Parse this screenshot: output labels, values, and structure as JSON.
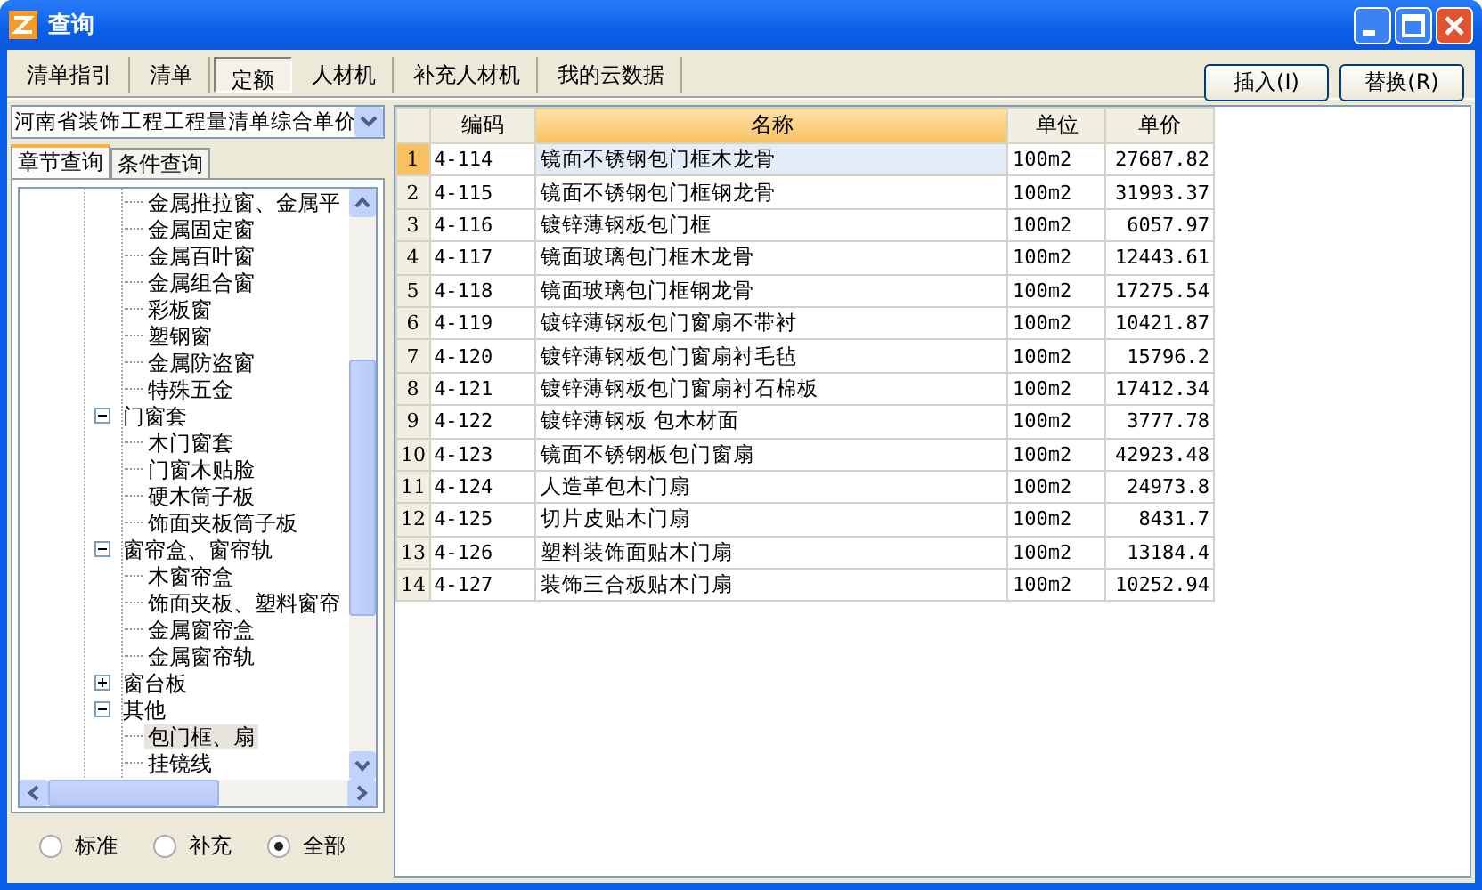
{
  "window": {
    "title": "查询"
  },
  "tabs": [
    {
      "label": "清单指引",
      "selected": false
    },
    {
      "label": "清单",
      "selected": false
    },
    {
      "label": "定额",
      "selected": true
    },
    {
      "label": "人材机",
      "selected": false
    },
    {
      "label": "补充人材机",
      "selected": false
    },
    {
      "label": "我的云数据",
      "selected": false
    }
  ],
  "buttons": [
    "插入(I)",
    "替换(R)"
  ],
  "library": {
    "value": "河南省装饰工程工程量清单综合单价"
  },
  "search_tabs": [
    {
      "label": "章节查询",
      "selected": true
    },
    {
      "label": "条件查询",
      "selected": false
    }
  ],
  "tree": [
    {
      "children": [
        {
          "label": "金属推拉窗、金属平",
          "selected": false
        },
        {
          "label": "金属固定窗",
          "selected": false
        },
        {
          "label": "金属百叶窗",
          "selected": false
        },
        {
          "label": "金属组合窗",
          "selected": false
        },
        {
          "label": "彩板窗",
          "selected": false
        },
        {
          "label": "塑钢窗",
          "selected": false
        },
        {
          "label": "金属防盗窗",
          "selected": false
        },
        {
          "label": "特殊五金",
          "selected": false
        }
      ]
    },
    {
      "label": "门窗套",
      "selected": false,
      "expanded": true,
      "children": [
        {
          "label": "木门窗套",
          "selected": false
        },
        {
          "label": "门窗木贴脸",
          "selected": false
        },
        {
          "label": "硬木筒子板",
          "selected": false
        },
        {
          "label": "饰面夹板筒子板",
          "selected": false
        }
      ]
    },
    {
      "label": "窗帘盒、窗帘轨",
      "selected": false,
      "expanded": true,
      "children": [
        {
          "label": "木窗帘盒",
          "selected": false
        },
        {
          "label": "饰面夹板、塑料窗帘",
          "selected": false
        },
        {
          "label": "金属窗帘盒",
          "selected": false
        },
        {
          "label": "金属窗帘轨",
          "selected": false
        }
      ]
    },
    {
      "label": "窗台板",
      "selected": false,
      "expanded": false
    },
    {
      "label": "其他",
      "selected": false,
      "expanded": true,
      "children": [
        {
          "label": "包门框、扇",
          "selected": true
        },
        {
          "label": "挂镜线",
          "selected": false
        }
      ]
    }
  ],
  "filter": [
    {
      "label": "标准",
      "selected": false
    },
    {
      "label": "补充",
      "selected": false
    },
    {
      "label": "全部",
      "selected": true
    }
  ],
  "table": {
    "columns": [
      {
        "label": "编码",
        "selected": false
      },
      {
        "label": "名称",
        "selected": true
      },
      {
        "label": "单位",
        "selected": false
      },
      {
        "label": "单价",
        "selected": false
      }
    ],
    "rows": [
      {
        "index": "1",
        "code": "4-114",
        "name": "镜面不锈钢包门框木龙骨",
        "unit": "100m2",
        "price": "27687.82",
        "selected": true
      },
      {
        "index": "2",
        "code": "4-115",
        "name": "镜面不锈钢包门框钢龙骨",
        "unit": "100m2",
        "price": "31993.37",
        "selected": false
      },
      {
        "index": "3",
        "code": "4-116",
        "name": "镀锌薄钢板包门框",
        "unit": "100m2",
        "price": "6057.97",
        "selected": false
      },
      {
        "index": "4",
        "code": "4-117",
        "name": "镜面玻璃包门框木龙骨",
        "unit": "100m2",
        "price": "12443.61",
        "selected": false
      },
      {
        "index": "5",
        "code": "4-118",
        "name": "镜面玻璃包门框钢龙骨",
        "unit": "100m2",
        "price": "17275.54",
        "selected": false
      },
      {
        "index": "6",
        "code": "4-119",
        "name": "镀锌薄钢板包门窗扇不带衬",
        "unit": "100m2",
        "price": "10421.87",
        "selected": false
      },
      {
        "index": "7",
        "code": "4-120",
        "name": "镀锌薄钢板包门窗扇衬毛毡",
        "unit": "100m2",
        "price": "15796.2",
        "selected": false
      },
      {
        "index": "8",
        "code": "4-121",
        "name": "镀锌薄钢板包门窗扇衬石棉板",
        "unit": "100m2",
        "price": "17412.34",
        "selected": false
      },
      {
        "index": "9",
        "code": "4-122",
        "name": "镀锌薄钢板 包木材面",
        "unit": "100m2",
        "price": "3777.78",
        "selected": false
      },
      {
        "index": "10",
        "code": "4-123",
        "name": "镜面不锈钢板包门窗扇",
        "unit": "100m2",
        "price": "42923.48",
        "selected": false
      },
      {
        "index": "11",
        "code": "4-124",
        "name": "人造革包木门扇",
        "unit": "100m2",
        "price": "24973.8",
        "selected": false
      },
      {
        "index": "12",
        "code": "4-125",
        "name": "切片皮贴木门扇",
        "unit": "100m2",
        "price": "8431.7",
        "selected": false
      },
      {
        "index": "13",
        "code": "4-126",
        "name": "塑料装饰面贴木门扇",
        "unit": "100m2",
        "price": "13184.4",
        "selected": false
      },
      {
        "index": "14",
        "code": "4-127",
        "name": "装饰三合板贴木门扇",
        "unit": "100m2",
        "price": "10252.94",
        "selected": false
      }
    ]
  }
}
